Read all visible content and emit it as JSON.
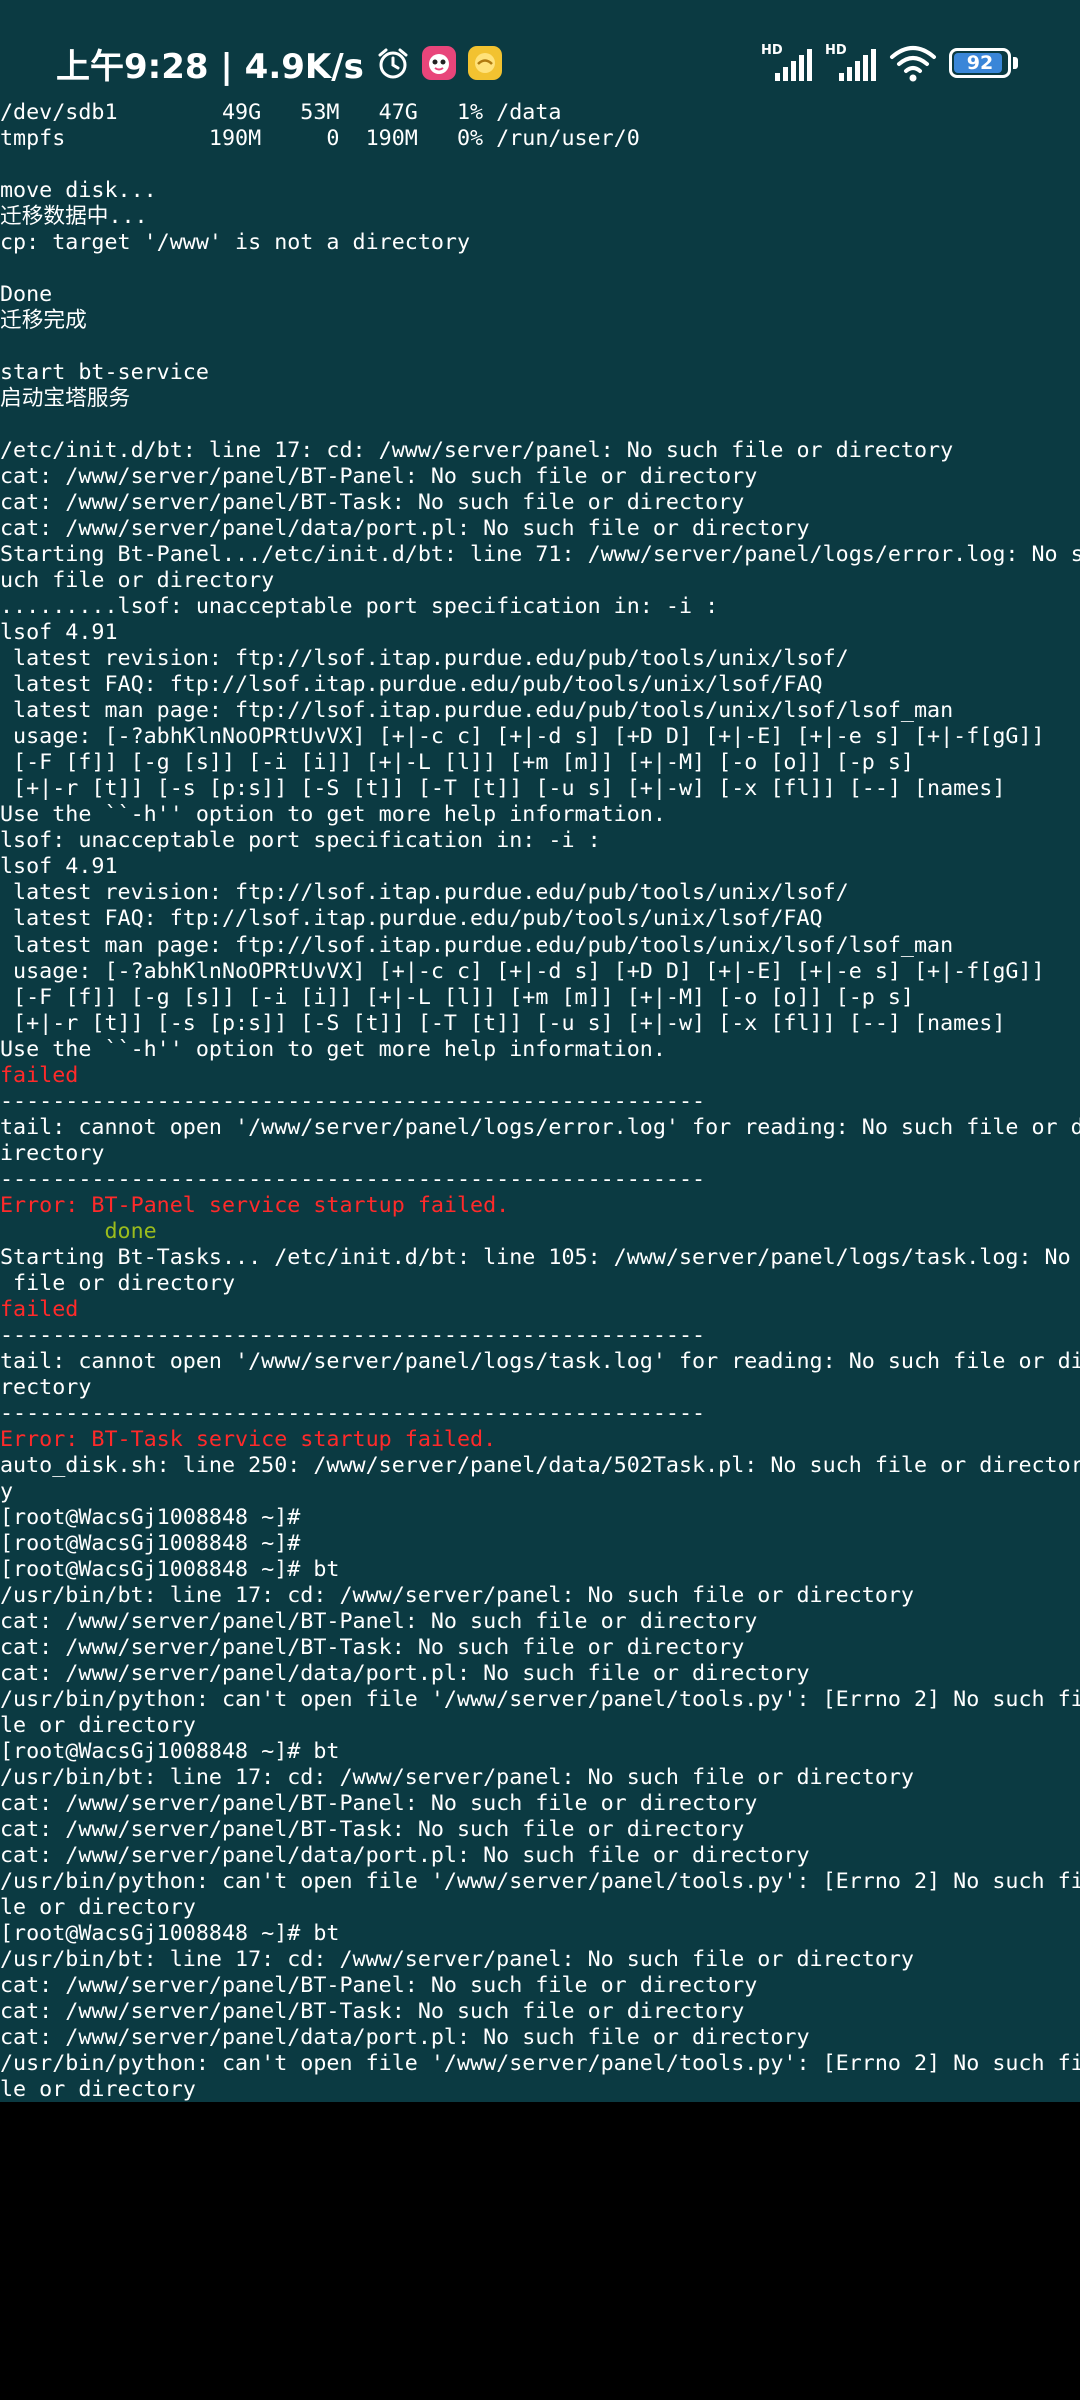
{
  "status_bar": {
    "time_speed": "上午9:28 | 4.9K/s",
    "icons": [
      "alarm-icon",
      "app-icon-pink",
      "app-icon-yellow"
    ],
    "signal_labels": [
      "HD",
      "HD"
    ],
    "battery_level": "92",
    "battery_fraction": 0.92
  },
  "colors": {
    "terminal_bg": "#0b3a42",
    "text": "#ffffff",
    "error": "#ff2a2a",
    "ok": "#9bbc1d",
    "battery": "#3a86d8",
    "below": "#000000"
  },
  "terminal": {
    "lines": [
      {
        "text": "/dev/sdb1        49G   53M   47G   1% /data"
      },
      {
        "text": "tmpfs           190M     0  190M   0% /run/user/0"
      },
      {
        "text": ""
      },
      {
        "text": "move disk..."
      },
      {
        "text": "迁移数据中..."
      },
      {
        "text": "cp: target '/www' is not a directory"
      },
      {
        "text": ""
      },
      {
        "text": "Done"
      },
      {
        "text": "迁移完成"
      },
      {
        "text": ""
      },
      {
        "text": "start bt-service"
      },
      {
        "text": "启动宝塔服务"
      },
      {
        "text": ""
      },
      {
        "text": "/etc/init.d/bt: line 17: cd: /www/server/panel: No such file or directory"
      },
      {
        "text": "cat: /www/server/panel/BT-Panel: No such file or directory"
      },
      {
        "text": "cat: /www/server/panel/BT-Task: No such file or directory"
      },
      {
        "text": "cat: /www/server/panel/data/port.pl: No such file or directory"
      },
      {
        "text": "Starting Bt-Panel.../etc/init.d/bt: line 71: /www/server/panel/logs/error.log: No s"
      },
      {
        "text": "uch file or directory"
      },
      {
        "text": ".........lsof: unacceptable port specification in: -i :"
      },
      {
        "text": "lsof 4.91"
      },
      {
        "text": " latest revision: ftp://lsof.itap.purdue.edu/pub/tools/unix/lsof/"
      },
      {
        "text": " latest FAQ: ftp://lsof.itap.purdue.edu/pub/tools/unix/lsof/FAQ"
      },
      {
        "text": " latest man page: ftp://lsof.itap.purdue.edu/pub/tools/unix/lsof/lsof_man"
      },
      {
        "text": " usage: [-?abhKlnNoOPRtUvVX] [+|-c c] [+|-d s] [+D D] [+|-E] [+|-e s] [+|-f[gG]]"
      },
      {
        "text": " [-F [f]] [-g [s]] [-i [i]] [+|-L [l]] [+m [m]] [+|-M] [-o [o]] [-p s]"
      },
      {
        "text": " [+|-r [t]] [-s [p:s]] [-S [t]] [-T [t]] [-u s] [+|-w] [-x [fl]] [--] [names]"
      },
      {
        "text": "Use the ``-h'' option to get more help information."
      },
      {
        "text": "lsof: unacceptable port specification in: -i :"
      },
      {
        "text": "lsof 4.91"
      },
      {
        "text": " latest revision: ftp://lsof.itap.purdue.edu/pub/tools/unix/lsof/"
      },
      {
        "text": " latest FAQ: ftp://lsof.itap.purdue.edu/pub/tools/unix/lsof/FAQ"
      },
      {
        "text": " latest man page: ftp://lsof.itap.purdue.edu/pub/tools/unix/lsof/lsof_man"
      },
      {
        "text": " usage: [-?abhKlnNoOPRtUvVX] [+|-c c] [+|-d s] [+D D] [+|-E] [+|-e s] [+|-f[gG]]"
      },
      {
        "text": " [-F [f]] [-g [s]] [-i [i]] [+|-L [l]] [+m [m]] [+|-M] [-o [o]] [-p s]"
      },
      {
        "text": " [+|-r [t]] [-s [p:s]] [-S [t]] [-T [t]] [-u s] [+|-w] [-x [fl]] [--] [names]"
      },
      {
        "text": "Use the ``-h'' option to get more help information."
      },
      {
        "text": "failed",
        "tone": "red"
      },
      {
        "text": "------------------------------------------------------"
      },
      {
        "text": "tail: cannot open '/www/server/panel/logs/error.log' for reading: No such file or d"
      },
      {
        "text": "irectory"
      },
      {
        "text": "------------------------------------------------------"
      },
      {
        "text": "Error: BT-Panel service startup failed.",
        "tone": "red"
      },
      {
        "text": "        done",
        "tone": "green"
      },
      {
        "text": "Starting Bt-Tasks... /etc/init.d/bt: line 105: /www/server/panel/logs/task.log: No"
      },
      {
        "text": " file or directory"
      },
      {
        "text": "failed",
        "tone": "red"
      },
      {
        "text": "------------------------------------------------------"
      },
      {
        "text": "tail: cannot open '/www/server/panel/logs/task.log' for reading: No such file or di"
      },
      {
        "text": "rectory"
      },
      {
        "text": "------------------------------------------------------"
      },
      {
        "text": "Error: BT-Task service startup failed.",
        "tone": "red"
      },
      {
        "text": "auto_disk.sh: line 250: /www/server/panel/data/502Task.pl: No such file or director"
      },
      {
        "text": "y"
      },
      {
        "text": "[root@WacsGj1008848 ~]#"
      },
      {
        "text": "[root@WacsGj1008848 ~]#"
      },
      {
        "text": "[root@WacsGj1008848 ~]# bt"
      },
      {
        "text": "/usr/bin/bt: line 17: cd: /www/server/panel: No such file or directory"
      },
      {
        "text": "cat: /www/server/panel/BT-Panel: No such file or directory"
      },
      {
        "text": "cat: /www/server/panel/BT-Task: No such file or directory"
      },
      {
        "text": "cat: /www/server/panel/data/port.pl: No such file or directory"
      },
      {
        "text": "/usr/bin/python: can't open file '/www/server/panel/tools.py': [Errno 2] No such fi"
      },
      {
        "text": "le or directory"
      },
      {
        "text": "[root@WacsGj1008848 ~]# bt"
      },
      {
        "text": "/usr/bin/bt: line 17: cd: /www/server/panel: No such file or directory"
      },
      {
        "text": "cat: /www/server/panel/BT-Panel: No such file or directory"
      },
      {
        "text": "cat: /www/server/panel/BT-Task: No such file or directory"
      },
      {
        "text": "cat: /www/server/panel/data/port.pl: No such file or directory"
      },
      {
        "text": "/usr/bin/python: can't open file '/www/server/panel/tools.py': [Errno 2] No such fi"
      },
      {
        "text": "le or directory"
      },
      {
        "text": "[root@WacsGj1008848 ~]# bt"
      },
      {
        "text": "/usr/bin/bt: line 17: cd: /www/server/panel: No such file or directory"
      },
      {
        "text": "cat: /www/server/panel/BT-Panel: No such file or directory"
      },
      {
        "text": "cat: /www/server/panel/BT-Task: No such file or directory"
      },
      {
        "text": "cat: /www/server/panel/data/port.pl: No such file or directory"
      },
      {
        "text": "/usr/bin/python: can't open file '/www/server/panel/tools.py': [Errno 2] No such fi"
      },
      {
        "text": "le or directory"
      }
    ]
  }
}
